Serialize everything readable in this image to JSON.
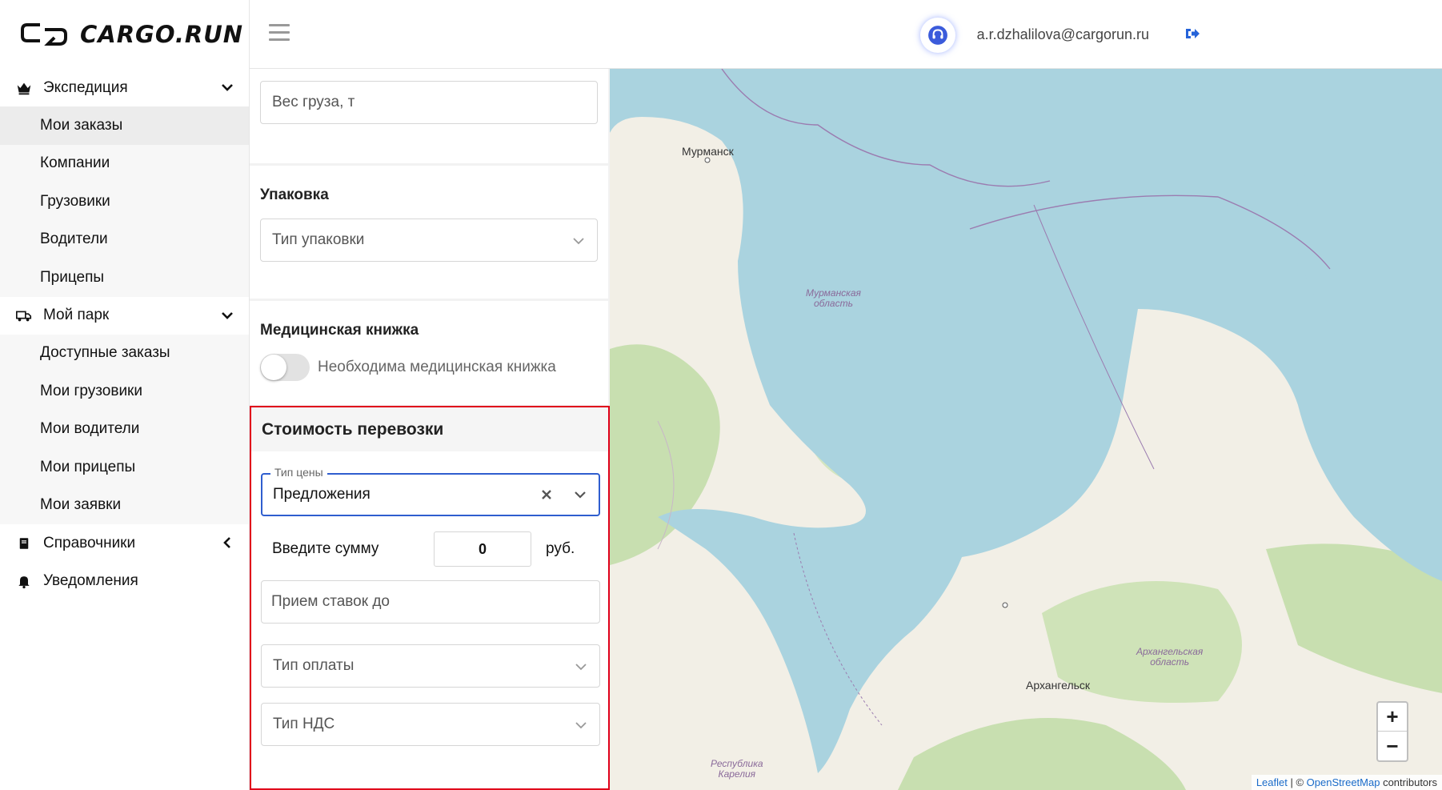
{
  "header": {
    "logo_text": "CARGO.RUN",
    "email": "a.r.dzhalilova@cargorun.ru"
  },
  "sidebar": {
    "groups": [
      {
        "label": "Экспедиция",
        "items": [
          "Мои заказы",
          "Компании",
          "Грузовики",
          "Водители",
          "Прицепы"
        ]
      },
      {
        "label": "Мой парк",
        "items": [
          "Доступные заказы",
          "Мои грузовики",
          "Мои водители",
          "Мои прицепы",
          "Мои заявки"
        ]
      },
      {
        "label": "Справочники",
        "items": []
      },
      {
        "label": "Уведомления",
        "items": []
      }
    ],
    "active_item": "Мои заказы"
  },
  "form": {
    "weight_placeholder": "Вес груза, т",
    "packaging": {
      "title": "Упаковка",
      "placeholder": "Тип упаковки"
    },
    "medical": {
      "title": "Медицинская книжка",
      "toggle_label": "Необходима медицинская книжка",
      "enabled": false
    },
    "price": {
      "title": "Стоимость перевозки",
      "price_type_legend": "Тип цены",
      "price_type_value": "Предложения",
      "sum_label": "Введите сумму",
      "sum_value": "0",
      "sum_unit": "руб.",
      "bids_until_placeholder": "Прием ставок до",
      "payment_type_placeholder": "Тип оплаты",
      "vat_type_placeholder": "Тип НДС"
    }
  },
  "map": {
    "labels": {
      "murmansk": "Мурманск",
      "murmansk_region": "Мурманская\nобласть",
      "arkhangelsk": "Архангельск",
      "arkhangelsk_region": "Архангельская\nобласть",
      "karelia": "Республика\nКарелия"
    },
    "zoom_in": "+",
    "zoom_out": "−",
    "attribution": {
      "leaflet": "Leaflet",
      "sep": " | © ",
      "osm": "OpenStreetMap",
      "contrib": " contributors"
    },
    "colors": {
      "water": "#aad3df",
      "land": "#f2efe6",
      "forest": "#c8dfb0"
    }
  }
}
